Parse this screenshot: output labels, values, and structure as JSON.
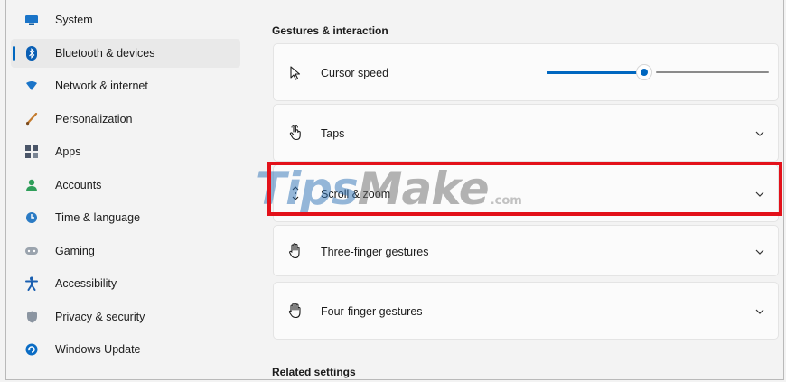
{
  "sidebar": {
    "items": [
      {
        "label": "System",
        "icon": "monitor-icon",
        "selected": false
      },
      {
        "label": "Bluetooth & devices",
        "icon": "bluetooth-icon",
        "selected": true
      },
      {
        "label": "Network & internet",
        "icon": "wifi-icon",
        "selected": false
      },
      {
        "label": "Personalization",
        "icon": "brush-icon",
        "selected": false
      },
      {
        "label": "Apps",
        "icon": "apps-icon",
        "selected": false
      },
      {
        "label": "Accounts",
        "icon": "person-icon",
        "selected": false
      },
      {
        "label": "Time & language",
        "icon": "globe-clock-icon",
        "selected": false
      },
      {
        "label": "Gaming",
        "icon": "gamepad-icon",
        "selected": false
      },
      {
        "label": "Accessibility",
        "icon": "accessibility-icon",
        "selected": false
      },
      {
        "label": "Privacy & security",
        "icon": "shield-icon",
        "selected": false
      },
      {
        "label": "Windows Update",
        "icon": "refresh-icon",
        "selected": false
      }
    ]
  },
  "main": {
    "section_title": "Gestures & interaction",
    "cursor_speed": {
      "label": "Cursor speed",
      "icon": "cursor-icon",
      "slider_value_fraction": 0.44
    },
    "rows": [
      {
        "label": "Taps",
        "icon": "tap-icon"
      },
      {
        "label": "Scroll & zoom",
        "icon": "scroll-icon"
      },
      {
        "label": "Three-finger gestures",
        "icon": "three-finger-icon"
      },
      {
        "label": "Four-finger gestures",
        "icon": "four-finger-icon"
      }
    ],
    "related_title": "Related settings"
  },
  "watermark": {
    "tips": "Tips",
    "make": "Make",
    "com": ".com"
  },
  "colors": {
    "accent": "#0067c0",
    "highlight": "#e3111a",
    "background": "#f3f3f3",
    "card": "#fbfbfb"
  }
}
